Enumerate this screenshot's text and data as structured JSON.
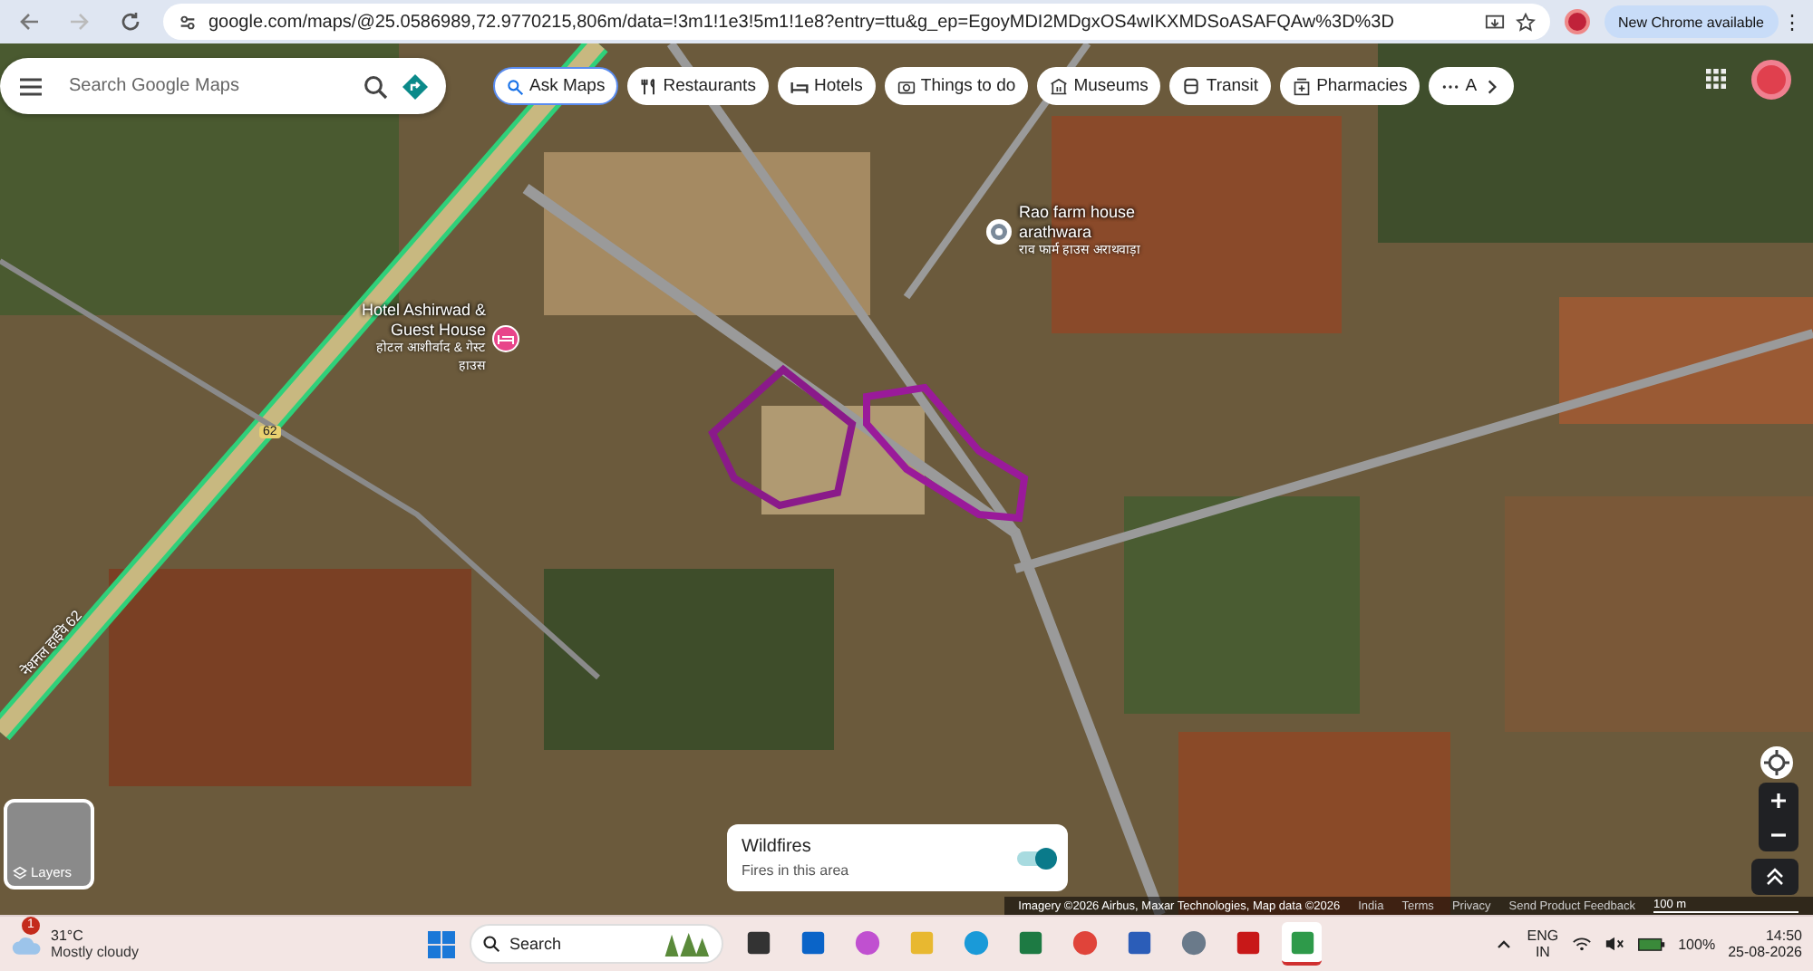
{
  "browser": {
    "url": "google.com/maps/@25.0586989,72.9770215,806m/data=!3m1!1e3!5m1!1e8?entry=ttu&g_ep=EgoyMDI2MDgxOS4wIKXMDSoASAFQAw%3D%3D",
    "update_label": "New Chrome available",
    "menu_glyph": "⋮"
  },
  "search": {
    "placeholder": "Search Google Maps"
  },
  "chips": [
    {
      "label": "Ask Maps",
      "kind": "ask",
      "selected": true
    },
    {
      "label": "Restaurants",
      "kind": "restaurant",
      "selected": false
    },
    {
      "label": "Hotels",
      "kind": "hotel",
      "selected": false
    },
    {
      "label": "Things to do",
      "kind": "camera",
      "selected": false
    },
    {
      "label": "Museums",
      "kind": "museum",
      "selected": false
    },
    {
      "label": "Transit",
      "kind": "transit",
      "selected": false
    },
    {
      "label": "Pharmacies",
      "kind": "pharmacy",
      "selected": false
    },
    {
      "label": "A",
      "kind": "more",
      "selected": false
    }
  ],
  "places": [
    {
      "kind": "farm",
      "name": "Rao farm house arathwara",
      "local_name": "राव फार्म हाउस अराथवाड़ा"
    },
    {
      "kind": "hotel",
      "name": "Hotel Ashirwad & Guest House",
      "local_name": "होटल आशीर्वाद & गेस्ट हाउस"
    }
  ],
  "roads": {
    "shield": "62",
    "highway_label": "नेशनल हाईवे 62"
  },
  "layers": {
    "label": "Layers"
  },
  "wildfires": {
    "title": "Wildfires",
    "subtitle": "Fires in this area",
    "on": true
  },
  "attribution": [
    "Imagery ©2026 Airbus, Maxar Technologies, Map data ©2026",
    "India",
    "Terms",
    "Privacy",
    "Send Product Feedback"
  ],
  "scale": "100 m",
  "taskbar": {
    "weather": {
      "temp": "31°C",
      "condition": "Mostly cloudy",
      "badge": "1"
    },
    "search": "Search",
    "apps": [
      {
        "kind": "terminal",
        "selected": false
      },
      {
        "kind": "outlook",
        "selected": false
      },
      {
        "kind": "copilot",
        "selected": false
      },
      {
        "kind": "folder",
        "selected": false
      },
      {
        "kind": "edge",
        "selected": false
      },
      {
        "kind": "excel",
        "selected": false
      },
      {
        "kind": "chrome",
        "selected": false
      },
      {
        "kind": "word",
        "selected": false
      },
      {
        "kind": "settings",
        "selected": false
      },
      {
        "kind": "pdf",
        "selected": false
      },
      {
        "kind": "doc",
        "selected": true
      }
    ],
    "lang": "ENG",
    "region": "IN",
    "battery": "100%",
    "time": "14:50",
    "date": "25-08-2026"
  }
}
